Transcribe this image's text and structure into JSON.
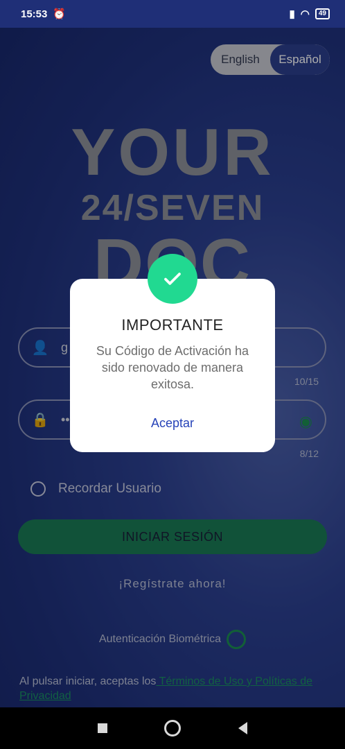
{
  "status": {
    "time": "15:53",
    "battery": "49"
  },
  "language": {
    "english": "English",
    "spanish": "Español"
  },
  "logo": {
    "line1": "YOUR",
    "line2": "24/SEVEN",
    "line3": "DOC"
  },
  "username": {
    "value": "g",
    "counter": "10/15"
  },
  "password": {
    "value": "••",
    "counter": "8/12"
  },
  "remember_label": "Recordar Usuario",
  "login_button": "INICIAR SESIÓN",
  "register_link": "¡Regístrate ahora!",
  "biometric_label": "Autenticación Biométrica",
  "terms": {
    "prefix": "Al pulsar iniciar, aceptas los",
    "link": " Términos de Uso y Políticas de Privacidad "
  },
  "dialog": {
    "title": "IMPORTANTE",
    "message": "Su Código de Activación ha sido renovado de manera exitosa.",
    "button": "Aceptar"
  },
  "colors": {
    "accent_green": "#21d991",
    "dialog_button": "#2643b8",
    "background": "#1e307a"
  }
}
